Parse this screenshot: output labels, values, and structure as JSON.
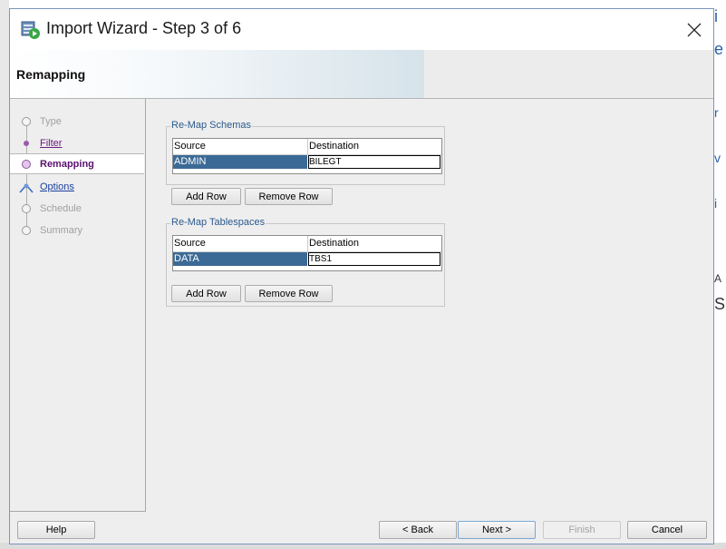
{
  "window": {
    "title": "Import Wizard - Step 3 of 6",
    "close_label": "✕"
  },
  "header": {
    "title": "Remapping"
  },
  "nav": {
    "items": [
      {
        "label": "Type",
        "state": "disabled"
      },
      {
        "label": "Filter",
        "state": "visited"
      },
      {
        "label": "Remapping",
        "state": "active"
      },
      {
        "label": "Options",
        "state": "link"
      },
      {
        "label": "Schedule",
        "state": "disabled"
      },
      {
        "label": "Summary",
        "state": "disabled"
      }
    ]
  },
  "schemas": {
    "title": "Re-Map Schemas",
    "columns": [
      "Source",
      "Destination"
    ],
    "rows": [
      {
        "source": "ADMIN",
        "destination": "BILEGT"
      }
    ],
    "add_row": "Add Row",
    "remove_row": "Remove Row"
  },
  "tablespaces": {
    "title": "Re-Map Tablespaces",
    "columns": [
      "Source",
      "Destination"
    ],
    "rows": [
      {
        "source": "DATA",
        "destination": "TBS1"
      }
    ],
    "add_row": "Add Row",
    "remove_row": "Remove Row"
  },
  "footer": {
    "help": "Help",
    "back": "< Back",
    "next": "Next >",
    "finish": "Finish",
    "cancel": "Cancel"
  },
  "colors": {
    "selection": "#3c6a96",
    "group_title": "#2b5a8e",
    "active_nav": "#5a1070",
    "dialog_border": "#7b95bd"
  }
}
